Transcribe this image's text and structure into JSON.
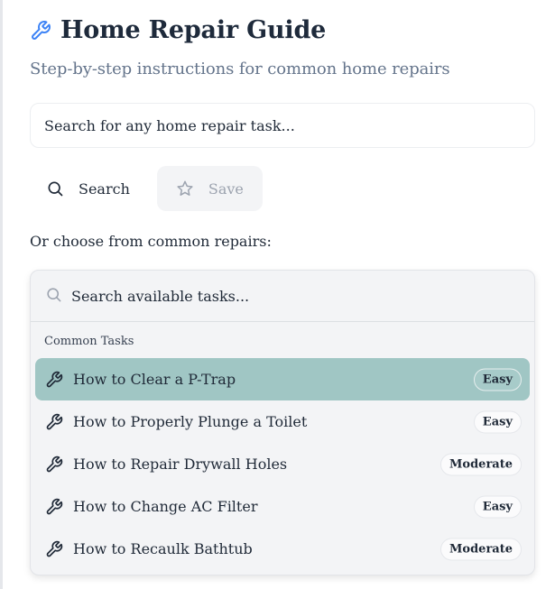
{
  "header": {
    "title": "Home Repair Guide",
    "subtitle": "Step-by-step instructions for common home repairs",
    "icon": "wrench-icon"
  },
  "search": {
    "placeholder": "Search for any home repair task..."
  },
  "actions": {
    "search_label": "Search",
    "save_label": "Save"
  },
  "choose_label": "Or choose from common repairs:",
  "dropdown": {
    "search_placeholder": "Search available tasks...",
    "group_label": "Common Tasks",
    "items": [
      {
        "label": "How to Clear a P-Trap",
        "difficulty": "Easy",
        "selected": true
      },
      {
        "label": "How to Properly Plunge a Toilet",
        "difficulty": "Easy",
        "selected": false
      },
      {
        "label": "How to Repair Drywall Holes",
        "difficulty": "Moderate",
        "selected": false
      },
      {
        "label": "How to Change AC Filter",
        "difficulty": "Easy",
        "selected": false
      },
      {
        "label": "How to Recaulk Bathtub",
        "difficulty": "Moderate",
        "selected": false
      }
    ]
  },
  "colors": {
    "accent": "#3b82f6",
    "selected_row": "#a0c6c4",
    "muted_text": "#64748b"
  }
}
